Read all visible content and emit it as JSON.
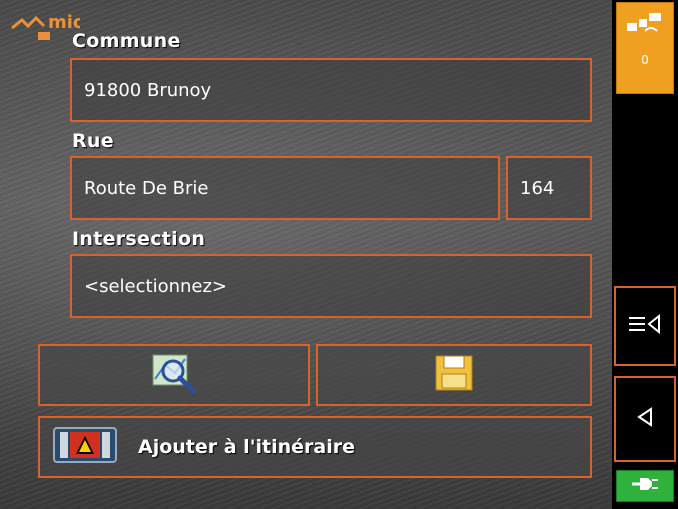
{
  "brand": {
    "logo_text": "mio"
  },
  "form": {
    "commune_label": "Commune",
    "commune_value": "91800 Brunoy",
    "rue_label": "Rue",
    "rue_value": "Route De Brie",
    "number_value": "164",
    "intersection_label": "Intersection",
    "intersection_value": "<selectionnez>"
  },
  "actions": {
    "map_search_icon": "map-magnifier-icon",
    "save_icon": "floppy-disk-icon",
    "add_route_label": "Ajouter à l'itinéraire",
    "add_route_icon": "route-warning-icon"
  },
  "sidebar": {
    "gps_count": "0",
    "gps_icon": "satellite-icon",
    "menu_icon": "menu-back-icon",
    "back_icon": "back-arrow-icon",
    "power_icon": "power-plug-icon"
  },
  "colors": {
    "accent": "#d9622a",
    "gps_bg": "#f0a020",
    "power_bg": "#2fb23c"
  }
}
